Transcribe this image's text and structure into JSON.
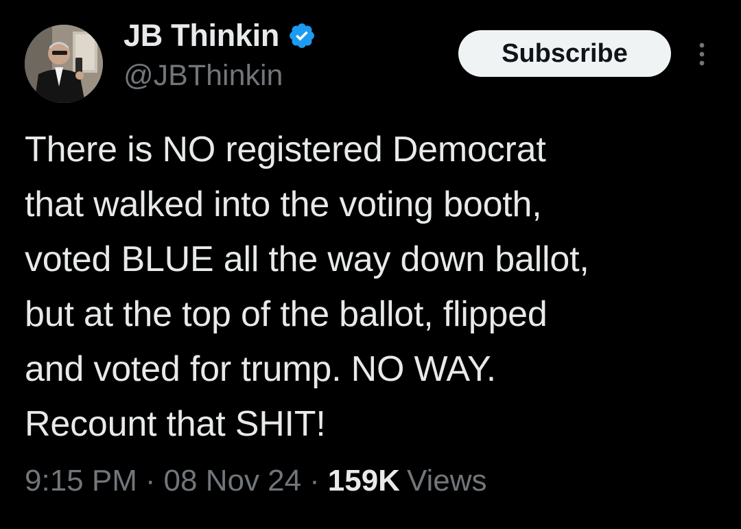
{
  "tweet": {
    "author": {
      "display_name": "JB Thinkin",
      "handle": "@JBThinkin",
      "verified_icon": "verified-badge-icon",
      "avatar_icon": "profile-photo"
    },
    "subscribe_label": "Subscribe",
    "more_icon": "more-options-icon",
    "text_lines": [
      "There is NO registered Democrat",
      "that walked into the voting booth,",
      "voted BLUE all the way down ballot,",
      "but at the top of the ballot, flipped",
      "and voted for trump. NO WAY.",
      "Recount that SHIT!"
    ],
    "time": "9:15 PM",
    "separator": "·",
    "date": "08 Nov 24",
    "views_count": "159K",
    "views_label": "Views"
  },
  "colors": {
    "background": "#000000",
    "primary_text": "#e7e9ea",
    "secondary_text": "#71767b",
    "verified_blue": "#1d9bf0",
    "button_bg": "#eff3f4"
  }
}
